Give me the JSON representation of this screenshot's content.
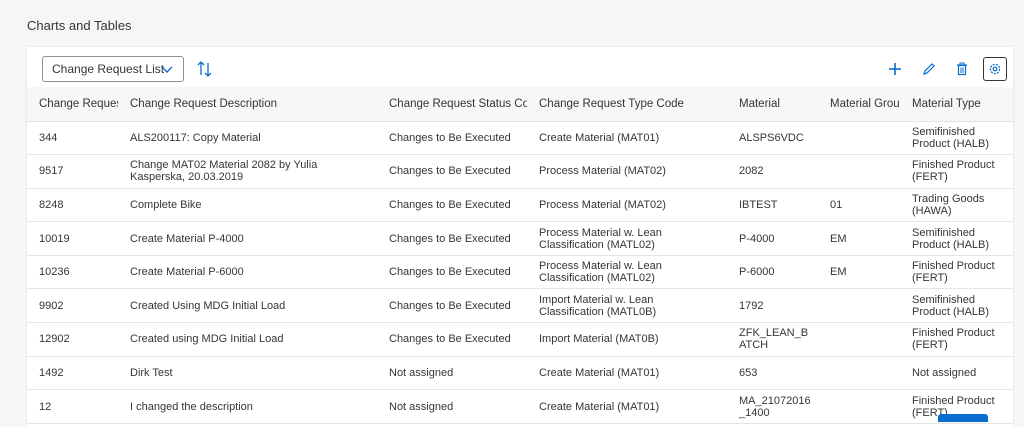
{
  "section_title": "Charts and Tables",
  "toolbar": {
    "view_select": "Change Request List",
    "icons": {
      "chevron": "chevron-down-icon",
      "sort": "sort-icon",
      "add": "add-icon",
      "edit": "edit-pencil-icon",
      "delete": "delete-trash-icon",
      "settings": "settings-gear-icon"
    }
  },
  "colors": {
    "accent": "#0a6ed1",
    "text": "#32363a",
    "header_bg": "#f7f7f7",
    "page_bg": "#f6f6f6"
  },
  "table": {
    "columns": [
      "Change Request",
      "Change Request Description",
      "Change Request Status Code",
      "Change Request Type Code",
      "Material",
      "Material Group",
      "Material Type"
    ],
    "rows": [
      [
        "344",
        "ALS200117: Copy Material",
        "Changes to Be Executed",
        "Create Material (MAT01)",
        "ALSPS6VDC",
        "",
        "Semifinished Product (HALB)"
      ],
      [
        "9517",
        "Change MAT02 Material 2082 by Yulia Kasperska, 20.03.2019",
        "Changes to Be Executed",
        "Process Material (MAT02)",
        "2082",
        "",
        "Finished Product (FERT)"
      ],
      [
        "8248",
        "Complete Bike",
        "Changes to Be Executed",
        "Process Material (MAT02)",
        "IBTEST",
        "01",
        "Trading Goods (HAWA)"
      ],
      [
        "10019",
        "Create Material P-4000",
        "Changes to Be Executed",
        "Process Material w. Lean Classification (MATL02)",
        "P-4000",
        "EM",
        "Semifinished Product (HALB)"
      ],
      [
        "10236",
        "Create Material P-6000",
        "Changes to Be Executed",
        "Process Material w. Lean Classification (MATL02)",
        "P-6000",
        "EM",
        "Finished Product (FERT)"
      ],
      [
        "9902",
        "Created Using MDG Initial Load",
        "Changes to Be Executed",
        "Import Material w. Lean Classification (MATL0B)",
        "1792",
        "",
        "Semifinished Product (HALB)"
      ],
      [
        "12902",
        "Created using MDG Initial Load",
        "Changes to Be Executed",
        "Import Material (MAT0B)",
        "ZFK_LEAN_BATCH",
        "",
        "Finished Product (FERT)"
      ],
      [
        "1492",
        "Dirk Test",
        "Not assigned",
        "Create Material (MAT01)",
        "653",
        "",
        "Not assigned"
      ],
      [
        "12",
        "I changed the description",
        "Not assigned",
        "Create Material (MAT01)",
        "MA_21072016_1400",
        "",
        "Finished Product (FERT)"
      ]
    ]
  }
}
